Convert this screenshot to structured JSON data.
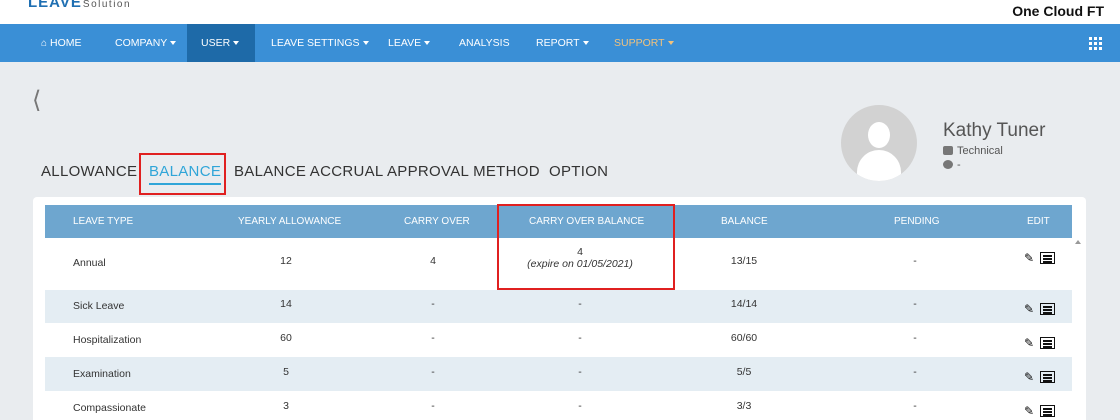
{
  "header": {
    "logo_main": "LEAVE",
    "logo_sub": "Solution",
    "company_name": "One Cloud FT"
  },
  "nav": {
    "items": [
      {
        "label": "HOME",
        "icon": "home-icon"
      },
      {
        "label": "COMPANY",
        "dropdown": true
      },
      {
        "label": "USER",
        "dropdown": true,
        "active": true
      },
      {
        "label": "LEAVE SETTINGS",
        "dropdown": true
      },
      {
        "label": "LEAVE",
        "dropdown": true
      },
      {
        "label": "ANALYSIS"
      },
      {
        "label": "REPORT",
        "dropdown": true
      },
      {
        "label": "SUPPORT",
        "dropdown": true
      }
    ],
    "apps_icon": "grid-icon"
  },
  "back_icon": "chevron-left-icon",
  "profile": {
    "name": "Kathy Tuner",
    "department": "Technical",
    "status": "-"
  },
  "tabs": [
    "ALLOWANCE",
    "BALANCE",
    "BALANCE ACCRUAL",
    "APPROVAL METHOD",
    "OPTION"
  ],
  "active_tab": "BALANCE",
  "table": {
    "columns": [
      "LEAVE TYPE",
      "YEARLY ALLOWANCE",
      "CARRY OVER",
      "CARRY OVER BALANCE",
      "BALANCE",
      "PENDING",
      "EDIT"
    ],
    "rows": [
      {
        "type": "Annual",
        "yearly": "12",
        "carry": "4",
        "carry_balance": "4",
        "carry_note": "(expire on 01/05/2021)",
        "balance": "13/15",
        "pending": "-"
      },
      {
        "type": "Sick Leave",
        "yearly": "14",
        "carry": "-",
        "carry_balance": "-",
        "carry_note": "",
        "balance": "14/14",
        "pending": "-"
      },
      {
        "type": "Hospitalization",
        "yearly": "60",
        "carry": "-",
        "carry_balance": "-",
        "carry_note": "",
        "balance": "60/60",
        "pending": "-"
      },
      {
        "type": "Examination",
        "yearly": "5",
        "carry": "-",
        "carry_balance": "-",
        "carry_note": "",
        "balance": "5/5",
        "pending": "-"
      },
      {
        "type": "Compassionate",
        "yearly": "3",
        "carry": "-",
        "carry_balance": "-",
        "carry_note": "",
        "balance": "3/3",
        "pending": "-"
      }
    ]
  },
  "colors": {
    "nav_bg": "#3a8fd6",
    "nav_active": "#1e6aa8",
    "header_row": "#6ea6cf",
    "highlight_box": "#e02020",
    "active_tab": "#2fa5d8"
  }
}
